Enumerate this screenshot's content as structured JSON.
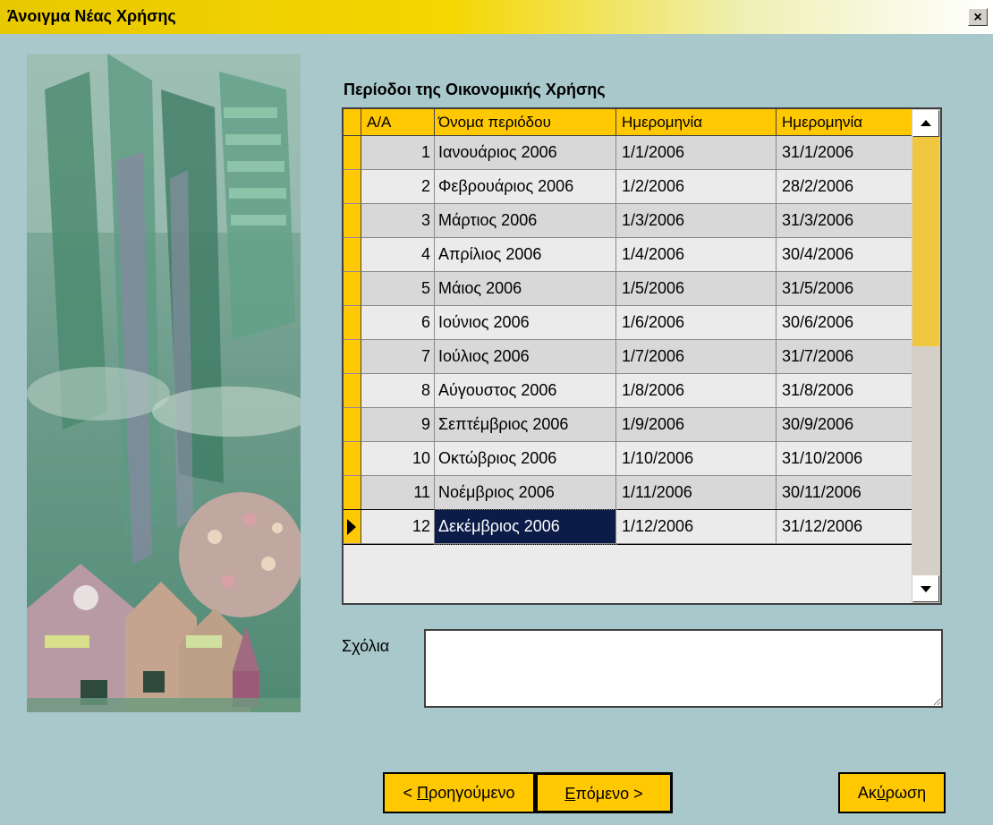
{
  "window": {
    "title": "Άνοιγμα Νέας Χρήσης",
    "close_label": "×"
  },
  "section_title": "Περίοδοι της Οικονομικής Χρήσης",
  "grid": {
    "columns": [
      "A/A",
      "Όνομα περιόδου",
      "Ημερομηνία",
      "Ημερομηνία"
    ],
    "rows": [
      {
        "aa": "1",
        "name": "Ιανουάριος 2006",
        "start": "1/1/2006",
        "end": "31/1/2006"
      },
      {
        "aa": "2",
        "name": "Φεβρουάριος 2006",
        "start": "1/2/2006",
        "end": "28/2/2006"
      },
      {
        "aa": "3",
        "name": "Μάρτιος 2006",
        "start": "1/3/2006",
        "end": "31/3/2006"
      },
      {
        "aa": "4",
        "name": "Απρίλιος 2006",
        "start": "1/4/2006",
        "end": "30/4/2006"
      },
      {
        "aa": "5",
        "name": "Μάιος 2006",
        "start": "1/5/2006",
        "end": "31/5/2006"
      },
      {
        "aa": "6",
        "name": "Ιούνιος 2006",
        "start": "1/6/2006",
        "end": "30/6/2006"
      },
      {
        "aa": "7",
        "name": "Ιούλιος 2006",
        "start": "1/7/2006",
        "end": "31/7/2006"
      },
      {
        "aa": "8",
        "name": "Αύγουστος 2006",
        "start": "1/8/2006",
        "end": "31/8/2006"
      },
      {
        "aa": "9",
        "name": "Σεπτέμβριος 2006",
        "start": "1/9/2006",
        "end": "30/9/2006"
      },
      {
        "aa": "10",
        "name": "Οκτώβριος 2006",
        "start": "1/10/2006",
        "end": "31/10/2006"
      },
      {
        "aa": "11",
        "name": "Νοέμβριος 2006",
        "start": "1/11/2006",
        "end": "30/11/2006"
      },
      {
        "aa": "12",
        "name": "Δεκέμβριος 2006",
        "start": "1/12/2006",
        "end": "31/12/2006"
      }
    ],
    "selected_row": 12
  },
  "comments": {
    "label": "Σχόλια",
    "value": ""
  },
  "buttons": {
    "prev": {
      "prefix": "< ",
      "accel": "Π",
      "rest": "ροηγούμενο"
    },
    "next": {
      "accel": "Ε",
      "rest": "πόμενο >"
    },
    "cancel": {
      "accel": "",
      "pre": "Ακ",
      "accel2": "ύ",
      "rest": "ρωση"
    }
  },
  "colors": {
    "accent": "#ffc800",
    "background": "#a9c8cc",
    "selection": "#0c1c48"
  },
  "icons": {
    "close": "close-icon",
    "scroll_up": "arrow-up-icon",
    "scroll_down": "arrow-down-icon",
    "row_pointer": "row-pointer-icon"
  }
}
